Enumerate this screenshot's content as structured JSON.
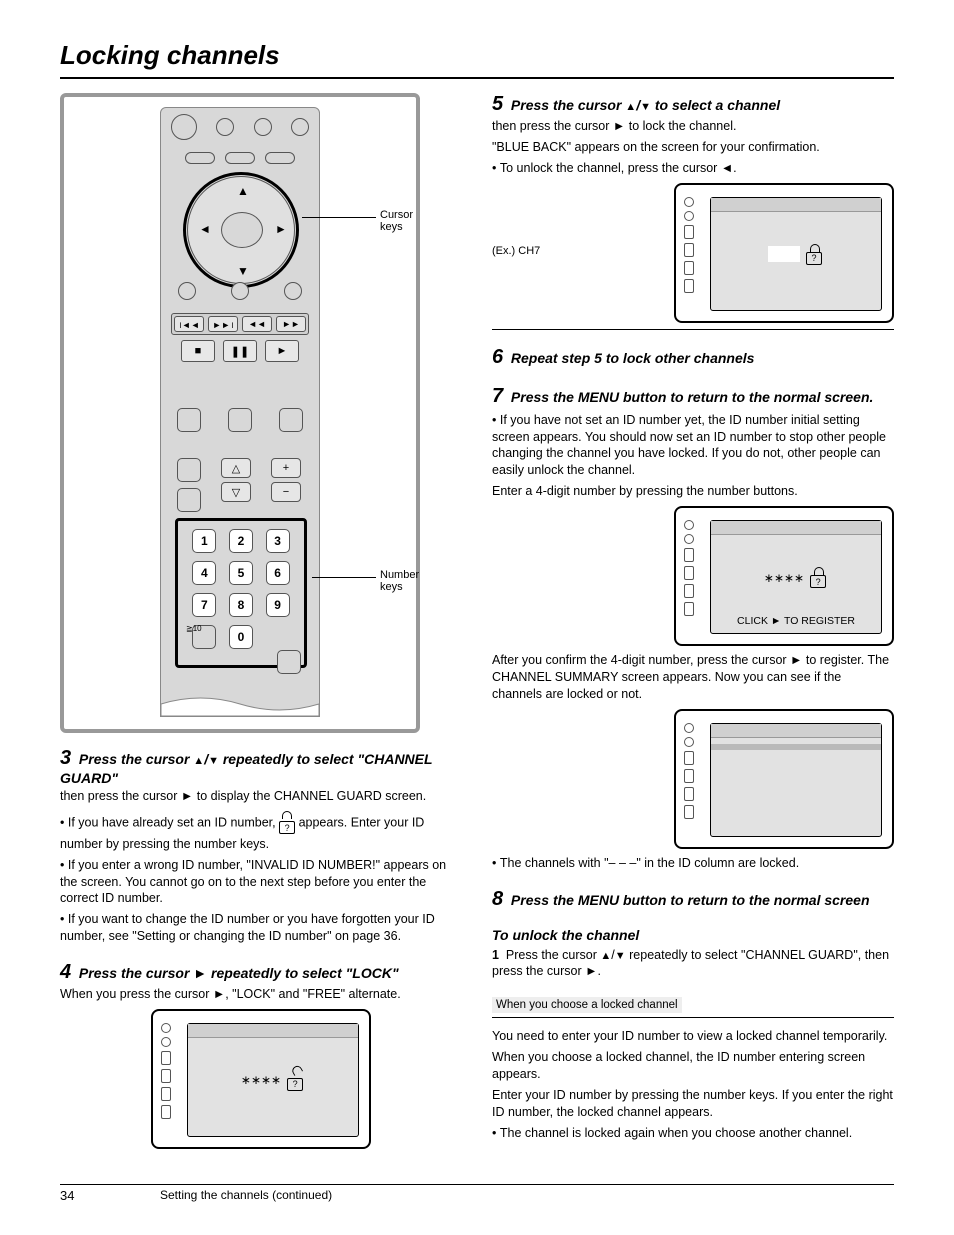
{
  "heading": "Locking channels",
  "remote": {
    "labels": {
      "cursor": "Cursor keys",
      "number": "Number keys"
    },
    "numpad": [
      "1",
      "2",
      "3",
      "4",
      "5",
      "6",
      "7",
      "8",
      "9",
      "0"
    ],
    "gte10": "≧10"
  },
  "left": {
    "b3_head": "3  Press the cursor ▲/▼ repeatedly to select \"CHANNEL GUARD\"",
    "b3_body1": "then press the cursor ► to display the CHANNEL GUARD screen.",
    "b3_body2_a": "If you have already set an ID number, ",
    "b3_body2_b": " appears. Enter your ID number by pressing the number keys.",
    "b3_body2_c": "If you enter a wrong ID number, \"INVALID ID NUMBER!\" appears on the screen. You cannot go on to the next step before you enter the correct ID number.",
    "b3_body2_d": "If you want to change the ID number or you have forgotten your ID number, see \"Setting or changing the ID number\" on page 36.",
    "b4_head": "4  Press the cursor ► repeatedly to select \"LOCK\"",
    "b4_body": "When you press the cursor ►, \"LOCK\" and \"FREE\" alternate.",
    "screen_stars": "∗∗∗∗"
  },
  "right": {
    "b5_head": "5  Press the cursor ▲/▼ to select a channel",
    "b5_body": "then press the cursor ► to lock the channel.",
    "b5_line1": "\"BLUE BACK\" appears on the screen for your confirmation.",
    "b5_line2": "To unlock the channel, press the cursor ◄.",
    "screen1_label": "(Ex.) CH7",
    "b6_head": "6  Repeat step 5 to lock other channels",
    "b7_head": "7  Press the MENU button to return to the normal screen.",
    "b7_body_a": "If you have not set an ID number yet, the ID number initial setting screen appears. You should now set an ID number to stop other people changing the channel you have locked. If you do not, other people can easily unlock the channel.",
    "b7_body_b": "Enter a 4-digit number by pressing the number buttons.",
    "b7_body_c": "After you confirm the 4-digit number, press the cursor ► to register. The CHANNEL SUMMARY screen appears. Now you can see if the channels are locked or not.",
    "b7_body_d": "The channels with \"– – –\" in the ID column are locked.",
    "screen2_click": "CLICK ► TO REGISTER",
    "b8_head": "8  Press the MENU button to return to the normal screen",
    "unlock_head": "To unlock the channel",
    "unlock_body": "1  Press the cursor ▲/▼ repeatedly to select \"CHANNEL GUARD\", then press the cursor ►.",
    "view_head": "When you choose a locked channel",
    "view_body1": "You need to enter your ID number to view a locked channel temporarily.",
    "view_body2": "When you choose a locked channel, the ID number entering screen appears.",
    "view_body3": "Enter your ID number by pressing the number keys. If you enter the right ID number, the locked channel appears.",
    "view_body4": "The channel is locked again when you choose another channel."
  },
  "footer": {
    "page": "34",
    "text": "Setting the channels (continued)"
  }
}
